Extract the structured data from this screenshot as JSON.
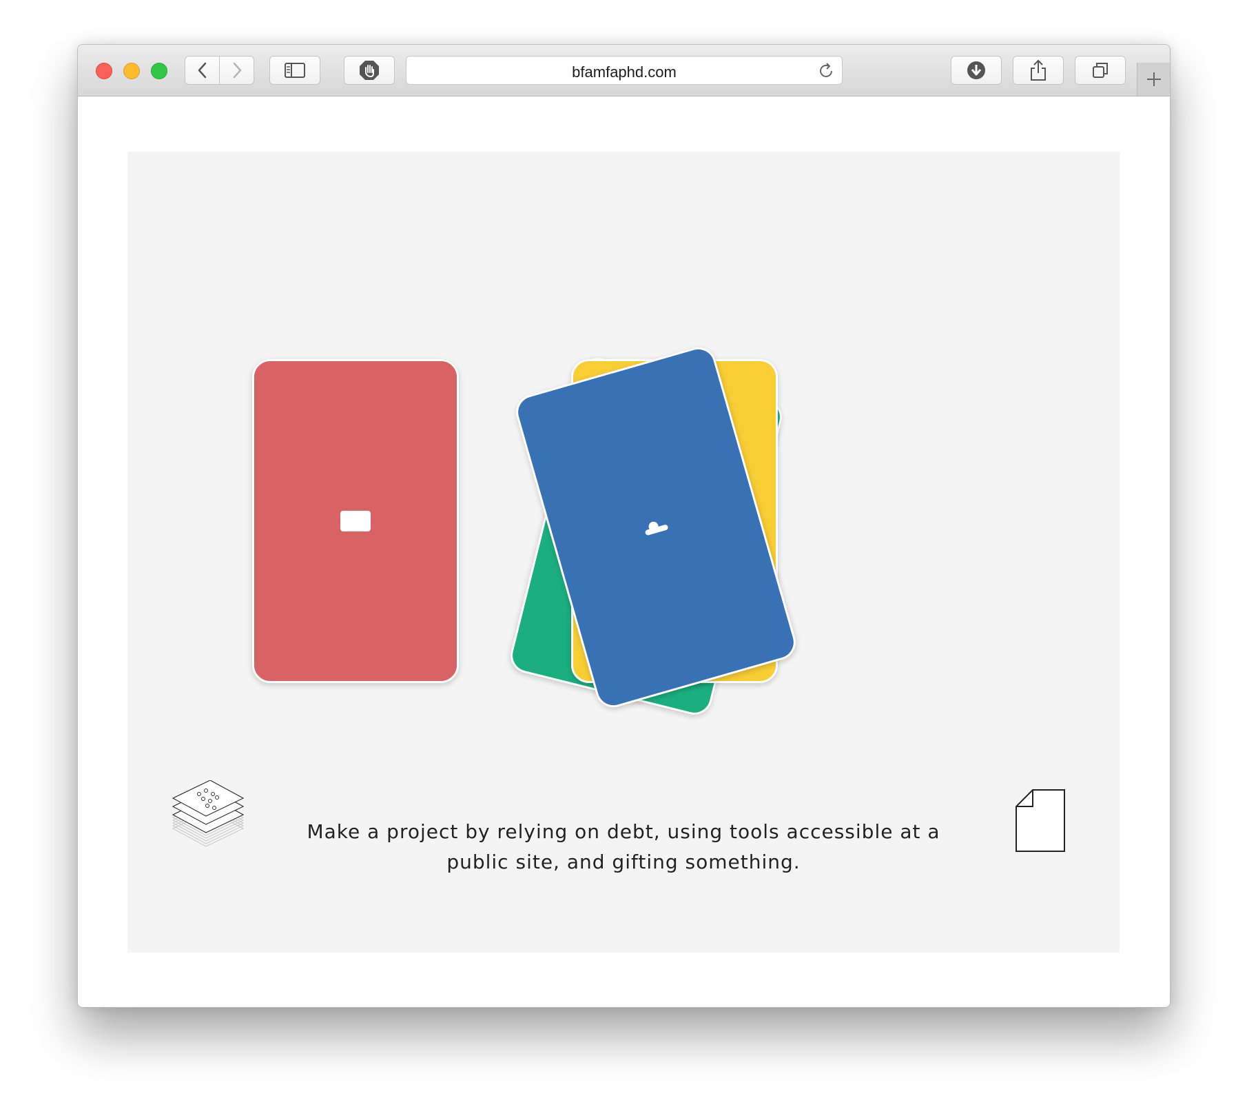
{
  "browser": {
    "url": "bfamfaphd.com",
    "buttons": {
      "back": "chevron-left-icon",
      "forward": "chevron-right-icon",
      "sidebar": "sidebar-icon",
      "extension": "hand-stop-icon",
      "reload": "reload-icon",
      "downloads": "download-icon",
      "share": "share-icon",
      "tabs": "tabs-overview-icon",
      "new_tab": "plus-icon"
    }
  },
  "page": {
    "cards": [
      {
        "color": "#d96364",
        "symbol": "rectangle-icon"
      },
      {
        "color": "#1baf7f",
        "symbol": ""
      },
      {
        "color": "#f8ce34",
        "symbol": ""
      },
      {
        "color": "#3871b4",
        "symbol": "cloud-icon"
      }
    ],
    "prompt_line1": "Make a project by relying on debt, using tools accessible at a",
    "prompt_line2": "public site, and gifting something.",
    "deck_icon": "card-deck-icon",
    "document_icon": "document-icon"
  }
}
